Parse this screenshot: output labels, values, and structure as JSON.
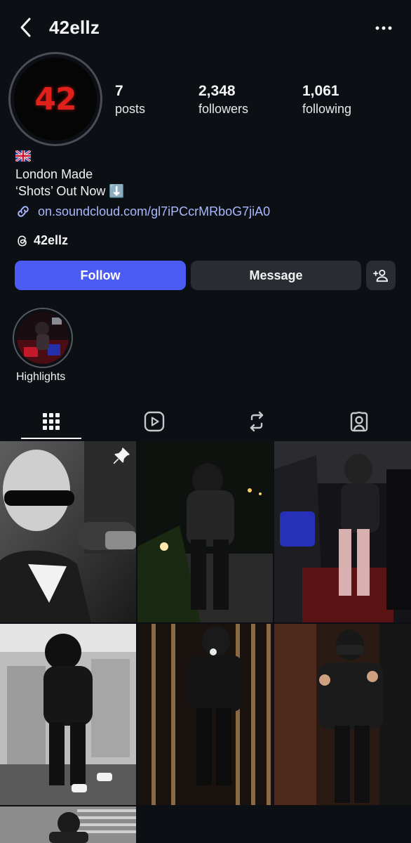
{
  "header": {
    "username": "42ellz",
    "back_icon": "chevron-left-icon",
    "more_icon": "more-horizontal-icon"
  },
  "profile": {
    "avatar_text": "42",
    "stats": {
      "posts_count": "7",
      "posts_label": "posts",
      "followers_count": "2,348",
      "followers_label": "followers",
      "following_count": "1,061",
      "following_label": "following"
    },
    "bio": {
      "flag_icon": "uk-flag-icon",
      "line1": "London Made",
      "line2": "‘Shots’ Out Now ⬇️",
      "link": "on.soundcloud.com/gl7iPCcrMRboG7jiA0",
      "threads_handle": "42ellz"
    }
  },
  "actions": {
    "follow_label": "Follow",
    "message_label": "Message",
    "add_user_icon": "person-add-icon"
  },
  "highlights": [
    {
      "label": "Highlights"
    }
  ],
  "tabs": [
    {
      "icon": "grid-icon",
      "active": true
    },
    {
      "icon": "reels-icon",
      "active": false
    },
    {
      "icon": "reposts-icon",
      "active": false
    },
    {
      "icon": "tagged-icon",
      "active": false
    }
  ],
  "grid": {
    "posts": [
      {
        "description": "post-1",
        "pinned": true
      },
      {
        "description": "post-2",
        "pinned": false
      },
      {
        "description": "post-3",
        "pinned": false
      },
      {
        "description": "post-4",
        "pinned": false
      },
      {
        "description": "post-5",
        "pinned": false
      },
      {
        "description": "post-6",
        "pinned": false
      },
      {
        "description": "post-7",
        "pinned": false
      }
    ]
  },
  "colors": {
    "background": "#0c0f14",
    "accent": "#4a5cf3",
    "link": "#a8b8ff",
    "button_secondary": "#2a2c33"
  }
}
